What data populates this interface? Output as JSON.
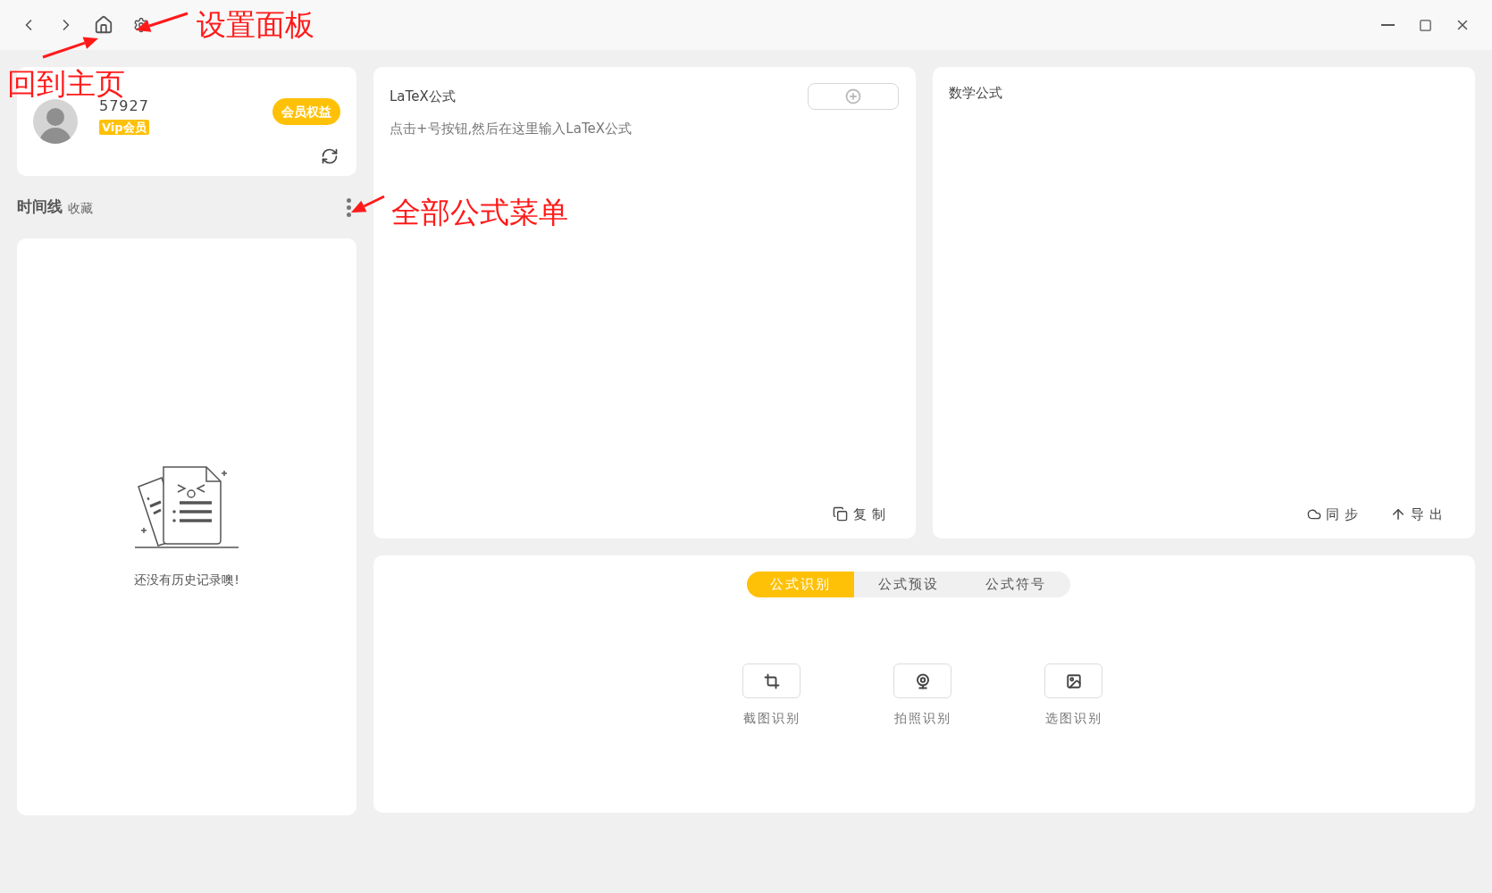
{
  "user": {
    "id": "57927",
    "badge": "Vip会员",
    "benefits_button": "会员权益"
  },
  "timeline": {
    "tabs": [
      {
        "label": "时间线",
        "selected": true
      },
      {
        "label": "收藏",
        "selected": false
      }
    ],
    "empty_message": "还没有历史记录噢!"
  },
  "latex_panel": {
    "title": "LaTeX公式",
    "placeholder": "点击+号按钮,然后在这里输入LaTeX公式",
    "copy_button": "复制"
  },
  "math_panel": {
    "title": "数学公式",
    "buttons": [
      {
        "kind": "sync",
        "label": "同步"
      },
      {
        "kind": "export",
        "label": "导出"
      }
    ]
  },
  "recognition": {
    "tabs": [
      {
        "label": "公式识别",
        "selected": true
      },
      {
        "label": "公式预设",
        "selected": false
      },
      {
        "label": "公式符号",
        "selected": false
      }
    ],
    "actions": [
      {
        "kind": "screenshot",
        "label": "截图识别"
      },
      {
        "kind": "camera",
        "label": "拍照识别"
      },
      {
        "kind": "image",
        "label": "选图识别"
      }
    ]
  },
  "annotations": [
    {
      "kind": "settings",
      "text": "设置面板"
    },
    {
      "kind": "home",
      "text": "回到主页"
    },
    {
      "kind": "menu",
      "text": "全部公式菜单"
    }
  ]
}
